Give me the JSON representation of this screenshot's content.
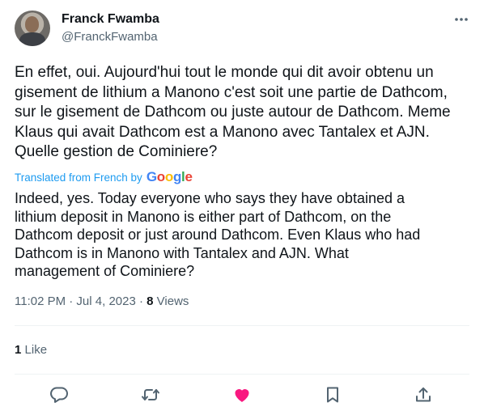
{
  "author": {
    "name": "Franck Fwamba",
    "handle": "@FranckFwamba"
  },
  "tweet": {
    "original_text": "En effet, oui. Aujourd'hui tout le monde qui dit avoir obtenu un\ngisement de lithium a Manono c'est soit une partie de Dathcom,\nsur le gisement de Dathcom ou juste autour de Dathcom. Meme\nKlaus qui avait Dathcom est a Manono avec Tantalex et AJN.\nQuelle gestion de Cominiere?",
    "translated_label": "Translated from French by",
    "translator": "Google",
    "translated_text": "Indeed, yes. Today everyone who says they have obtained a\nlithium deposit in Manono is either part of Dathcom, on the\nDathcom deposit or just around Dathcom. Even Klaus who had\nDathcom is in Manono with Tantalex and AJN. What\nmanagement of Cominiere?",
    "timestamp": "11:02 PM · Jul 4, 2023",
    "separator": "·",
    "views_count": "8",
    "views_label": "Views",
    "likes_count": "1",
    "likes_label": "Like"
  },
  "icons": {
    "more": "more-horizontal-icon",
    "reply": "reply-icon",
    "retweet": "retweet-icon",
    "like": "heart-icon",
    "bookmark": "bookmark-icon",
    "share": "share-icon"
  },
  "colors": {
    "text": "#0f1419",
    "secondary": "#536471",
    "link": "#1d9bf0",
    "like_active": "#f91880",
    "divider": "#eff3f4"
  }
}
